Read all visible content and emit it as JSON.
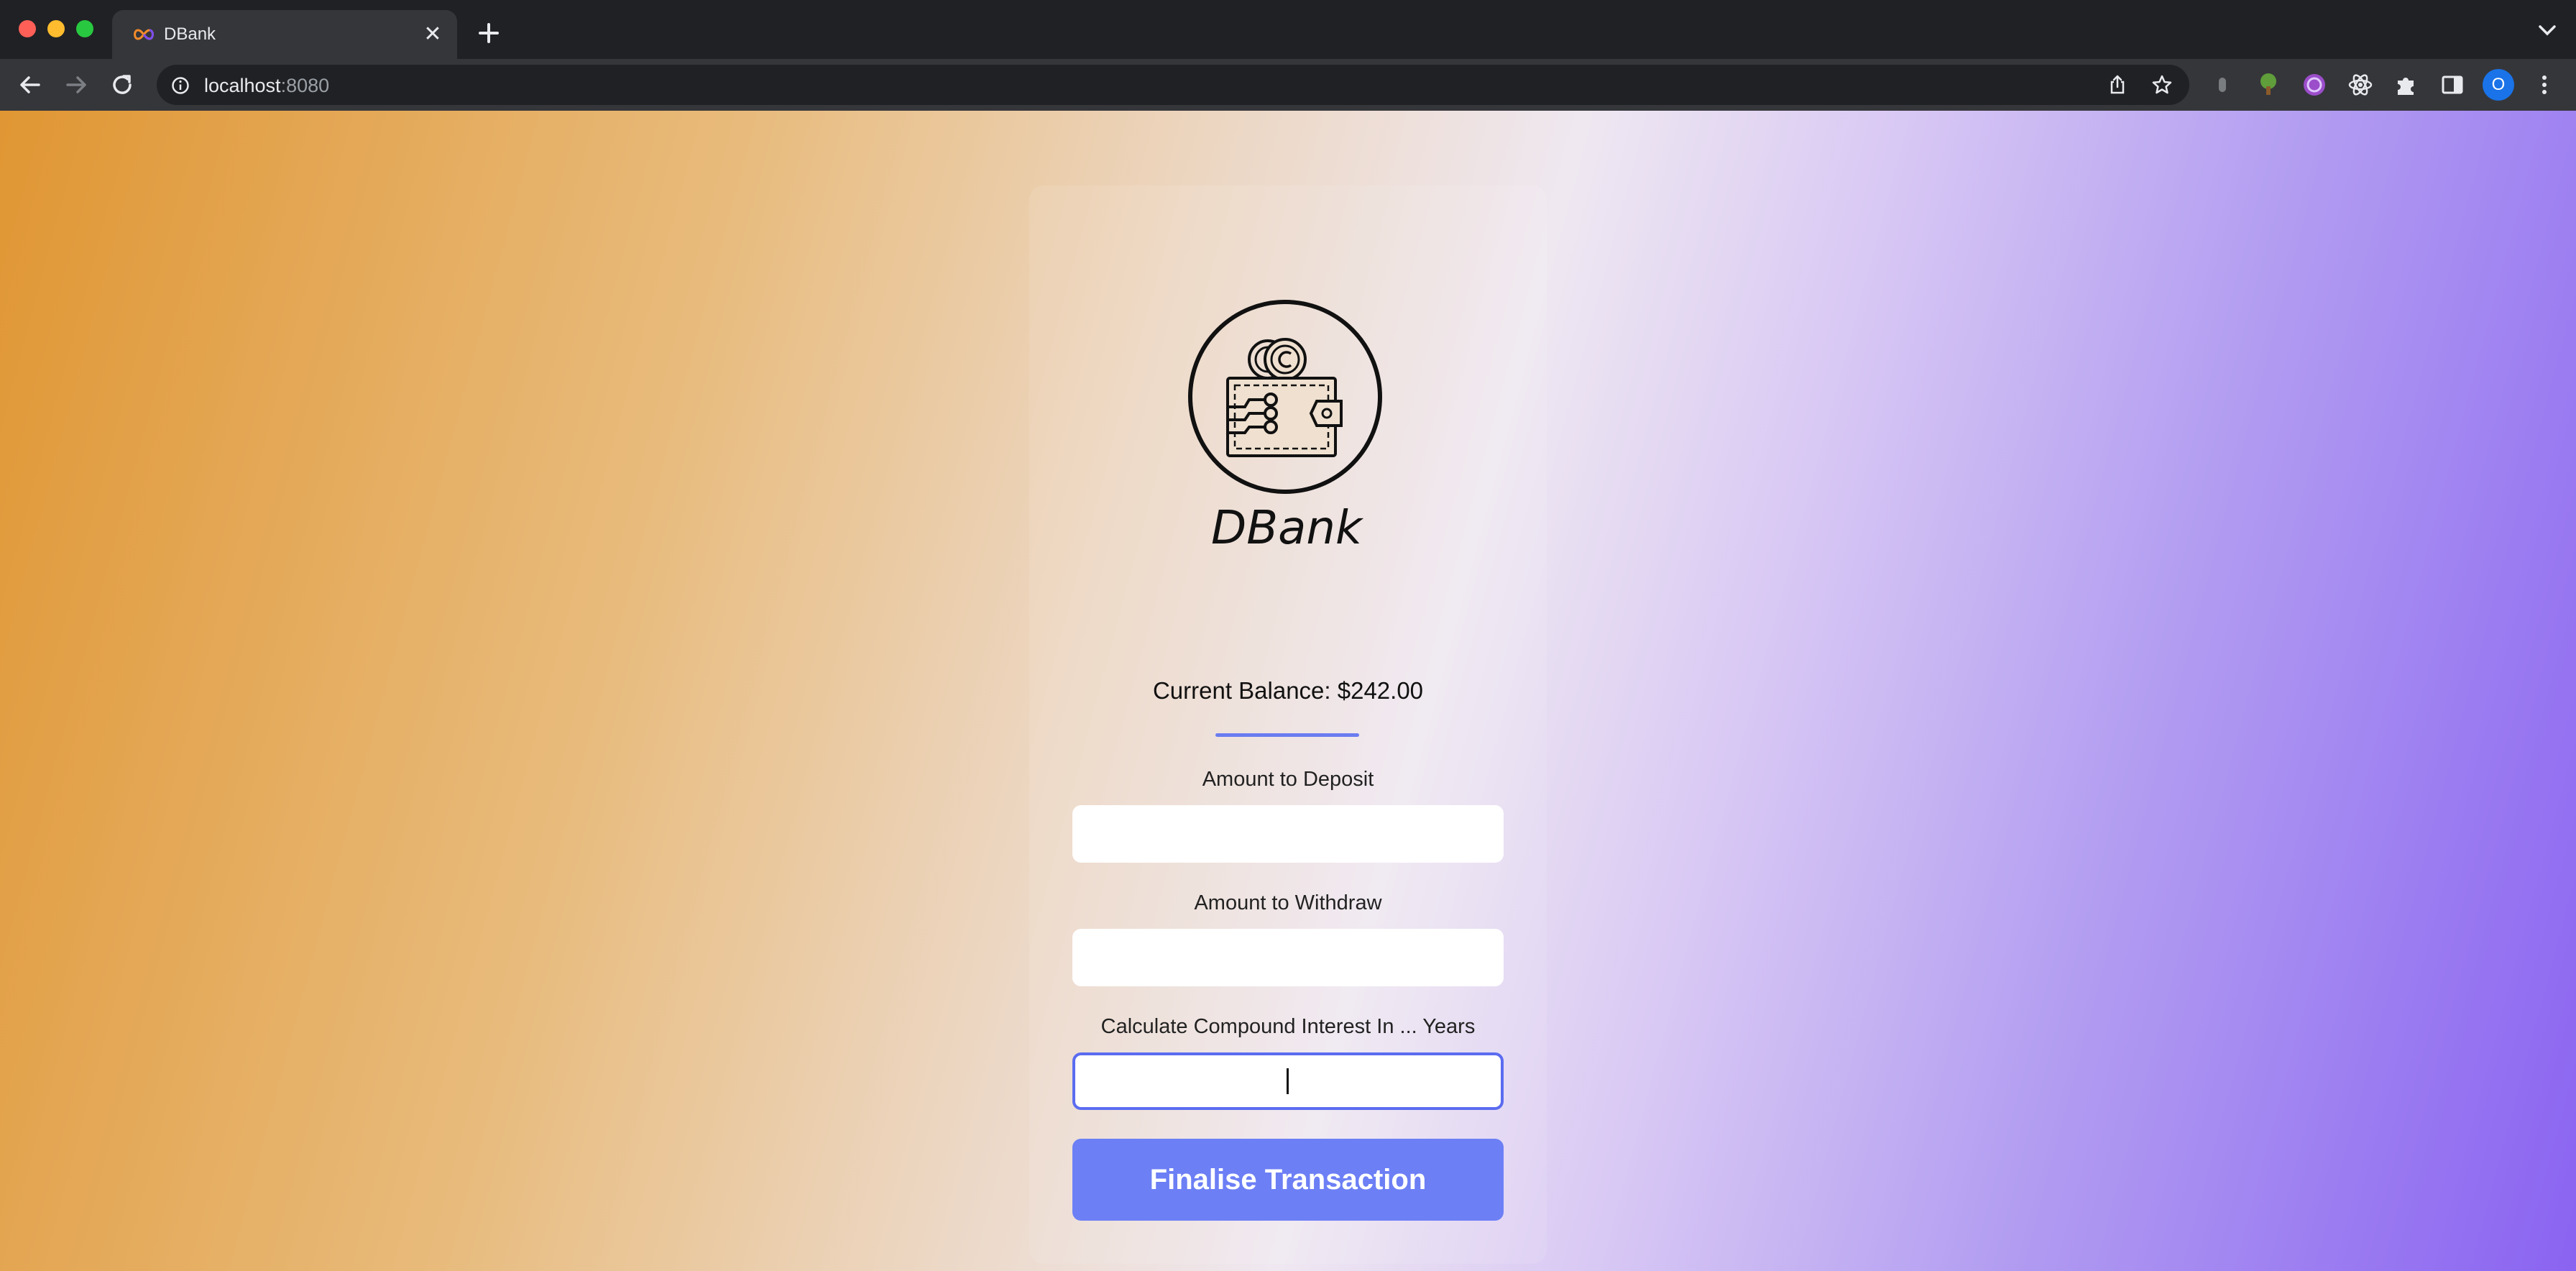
{
  "browser": {
    "tab_title": "DBank",
    "tab_close_glyph": "✕",
    "url_host": "localhost",
    "url_port": ":8080",
    "profile_initial": "O"
  },
  "app": {
    "brand": "DBank",
    "balance_label": "Current Balance: $242.00",
    "deposit_label": "Amount to Deposit",
    "deposit_value": "",
    "withdraw_label": "Amount to Withdraw",
    "withdraw_value": "",
    "interest_label": "Calculate Compound Interest In ... Years",
    "interest_value": "",
    "submit_label": "Finalise Transaction"
  },
  "colors": {
    "accent": "#6c7ff5",
    "focus_border": "#5b6cf0"
  }
}
